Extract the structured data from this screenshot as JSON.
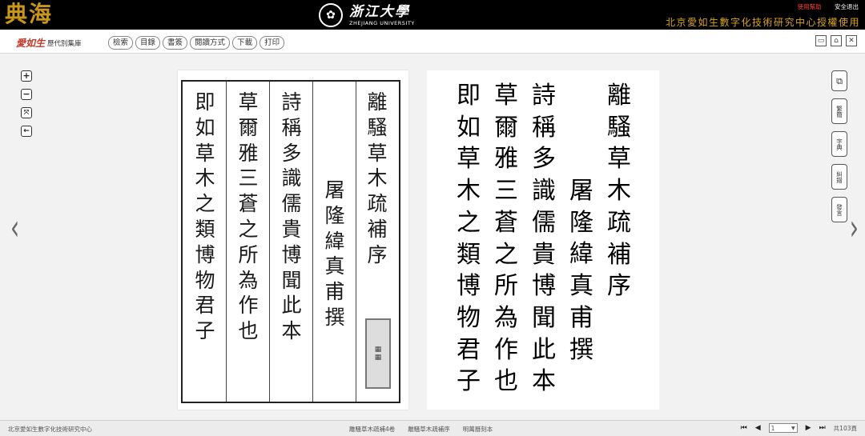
{
  "header": {
    "logo": "典海",
    "university_cn": "浙江大學",
    "university_en": "ZHEJIANG UNIVERSITY",
    "help_link": "使用幫助",
    "logout_link": "安全退出",
    "license_text": "北京愛如生數字化技術研究中心授權使用"
  },
  "toolbar": {
    "brand_name": "愛如生",
    "brand_sub": "歷代別集庫",
    "buttons": [
      "檢索",
      "目錄",
      "書簽",
      "閱讀方式",
      "下載",
      "打印"
    ]
  },
  "side_tools": [
    "繁簡",
    "字典",
    "糾錯",
    "發言"
  ],
  "scan_columns": [
    "離騷草木疏補序",
    "屠隆緯真甫撰",
    "詩稱多識儒貴博聞此本",
    "草爾雅三蒼之所為作也",
    "即如草木之類博物君子"
  ],
  "text_columns": [
    "離騷草木疏補序",
    "屠隆緯真甫撰",
    "詩稱多識儒貴博聞此本",
    "草爾雅三蒼之所為作也",
    "即如草木之類博物君子"
  ],
  "footer": {
    "org": "北京愛如生數字化技術研究中心",
    "breadcrumbs": [
      "離騷草木疏補4卷",
      "離騷草木疏補序",
      "明萬曆刻本"
    ],
    "current_page": "1",
    "total_pages": "共103頁"
  },
  "colors": {
    "header_bg": "#000000",
    "logo_gold": "#c9961a",
    "license_gold": "#d9a21c",
    "help_red": "#ff3b30"
  }
}
